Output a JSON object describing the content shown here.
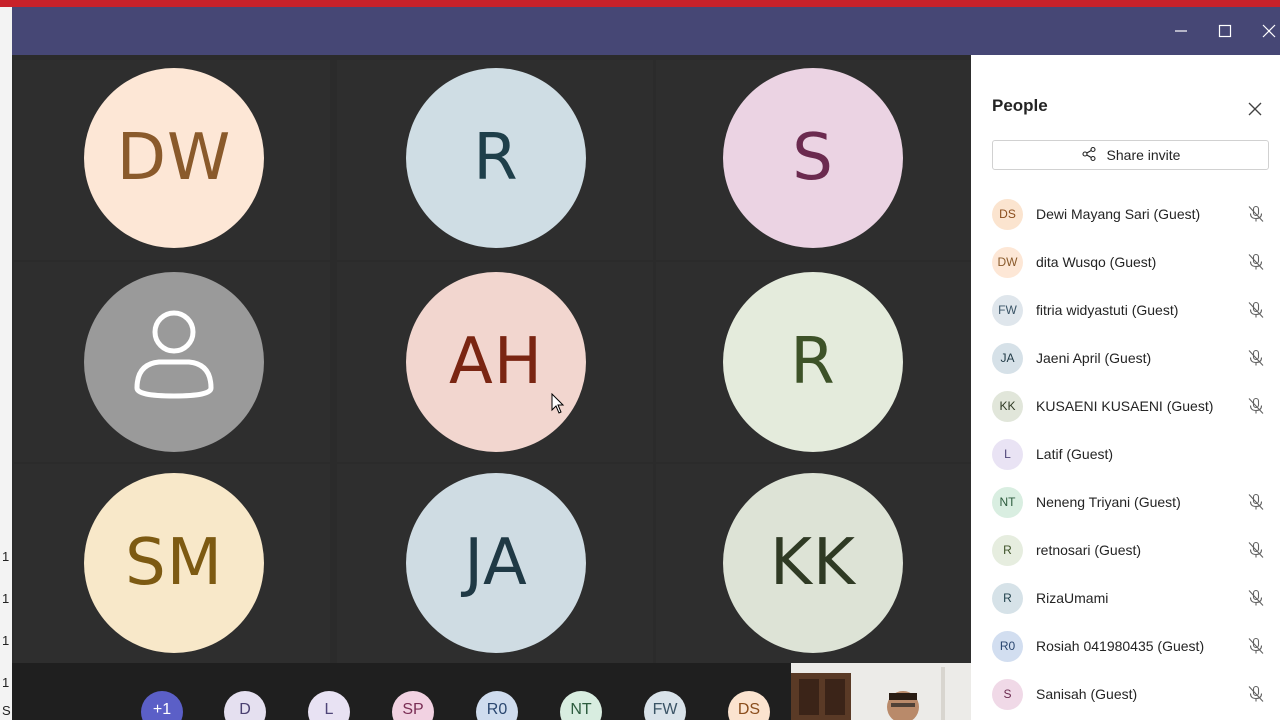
{
  "window": {
    "controls": [
      "minimize-icon",
      "maximize-icon",
      "close-icon"
    ]
  },
  "left_strip_marks": [
    "1",
    "1",
    "1",
    "1",
    "S"
  ],
  "grid": [
    {
      "initials": "DW",
      "bg": "#fde7d6",
      "fg": "#8a5a2b"
    },
    {
      "initials": "R",
      "bg": "#cfdde4",
      "fg": "#1f3f4a"
    },
    {
      "initials": "S",
      "bg": "#ebd3e3",
      "fg": "#6b2a4f"
    },
    {
      "initials": "",
      "bg": "#9a9a9a",
      "fg": "#ffffff",
      "icon": "person-icon"
    },
    {
      "initials": "AH",
      "bg": "#f2d6cf",
      "fg": "#7a2512"
    },
    {
      "initials": "R",
      "bg": "#e4ebdc",
      "fg": "#3d5228"
    },
    {
      "initials": "SM",
      "bg": "#f8e8c9",
      "fg": "#7d5a12"
    },
    {
      "initials": "JA",
      "bg": "#cfdce3",
      "fg": "#1f3945"
    },
    {
      "initials": "KK",
      "bg": "#dde3d6",
      "fg": "#2f3a24"
    }
  ],
  "bottom_bar": [
    {
      "label": "+1",
      "bg": "#5b5fc7",
      "fg": "#ffffff"
    },
    {
      "label": "D",
      "bg": "#e5e0f0",
      "fg": "#4a4070"
    },
    {
      "label": "L",
      "bg": "#e8e2f3",
      "fg": "#4f4578"
    },
    {
      "label": "SP",
      "bg": "#f2d2e2",
      "fg": "#7a2e55"
    },
    {
      "label": "R0",
      "bg": "#cfdcee",
      "fg": "#2b4770"
    },
    {
      "label": "NT",
      "bg": "#d8ede0",
      "fg": "#2d5c3e"
    },
    {
      "label": "FW",
      "bg": "#d9e3ea",
      "fg": "#3a5466"
    },
    {
      "label": "DS",
      "bg": "#fbe3cf",
      "fg": "#8a4d1c"
    }
  ],
  "panel": {
    "title": "People",
    "share_label": "Share invite",
    "people": [
      {
        "initials": "DS",
        "name": "Dewi Mayang Sari (Guest)",
        "bg": "#fbe4cf",
        "fg": "#8a4d1c",
        "muted": true
      },
      {
        "initials": "DW",
        "name": "dita Wusqo (Guest)",
        "bg": "#fde7d6",
        "fg": "#8a5a2b",
        "muted": true
      },
      {
        "initials": "FW",
        "name": "fitria widyastuti (Guest)",
        "bg": "#dfe6ec",
        "fg": "#3a5466",
        "muted": true
      },
      {
        "initials": "JA",
        "name": "Jaeni April (Guest)",
        "bg": "#d6e1e8",
        "fg": "#1f3945",
        "muted": true
      },
      {
        "initials": "KK",
        "name": "KUSAENI KUSAENI (Guest)",
        "bg": "#e1e6da",
        "fg": "#2f3a24",
        "muted": true
      },
      {
        "initials": "L",
        "name": "Latif (Guest)",
        "bg": "#e9e3f4",
        "fg": "#4f4578",
        "muted": false
      },
      {
        "initials": "NT",
        "name": "Neneng Triyani (Guest)",
        "bg": "#d9eee1",
        "fg": "#2d5c3e",
        "muted": true
      },
      {
        "initials": "R",
        "name": "retnosari (Guest)",
        "bg": "#e6eddf",
        "fg": "#3d5228",
        "muted": true
      },
      {
        "initials": "R",
        "name": "RizaUmami",
        "bg": "#d6e2e8",
        "fg": "#1f3f4a",
        "muted": true
      },
      {
        "initials": "R0",
        "name": "Rosiah 041980435 (Guest)",
        "bg": "#d2def0",
        "fg": "#2b4770",
        "muted": true
      },
      {
        "initials": "S",
        "name": "Sanisah (Guest)",
        "bg": "#f0d9e7",
        "fg": "#6b2a4f",
        "muted": true
      }
    ]
  }
}
